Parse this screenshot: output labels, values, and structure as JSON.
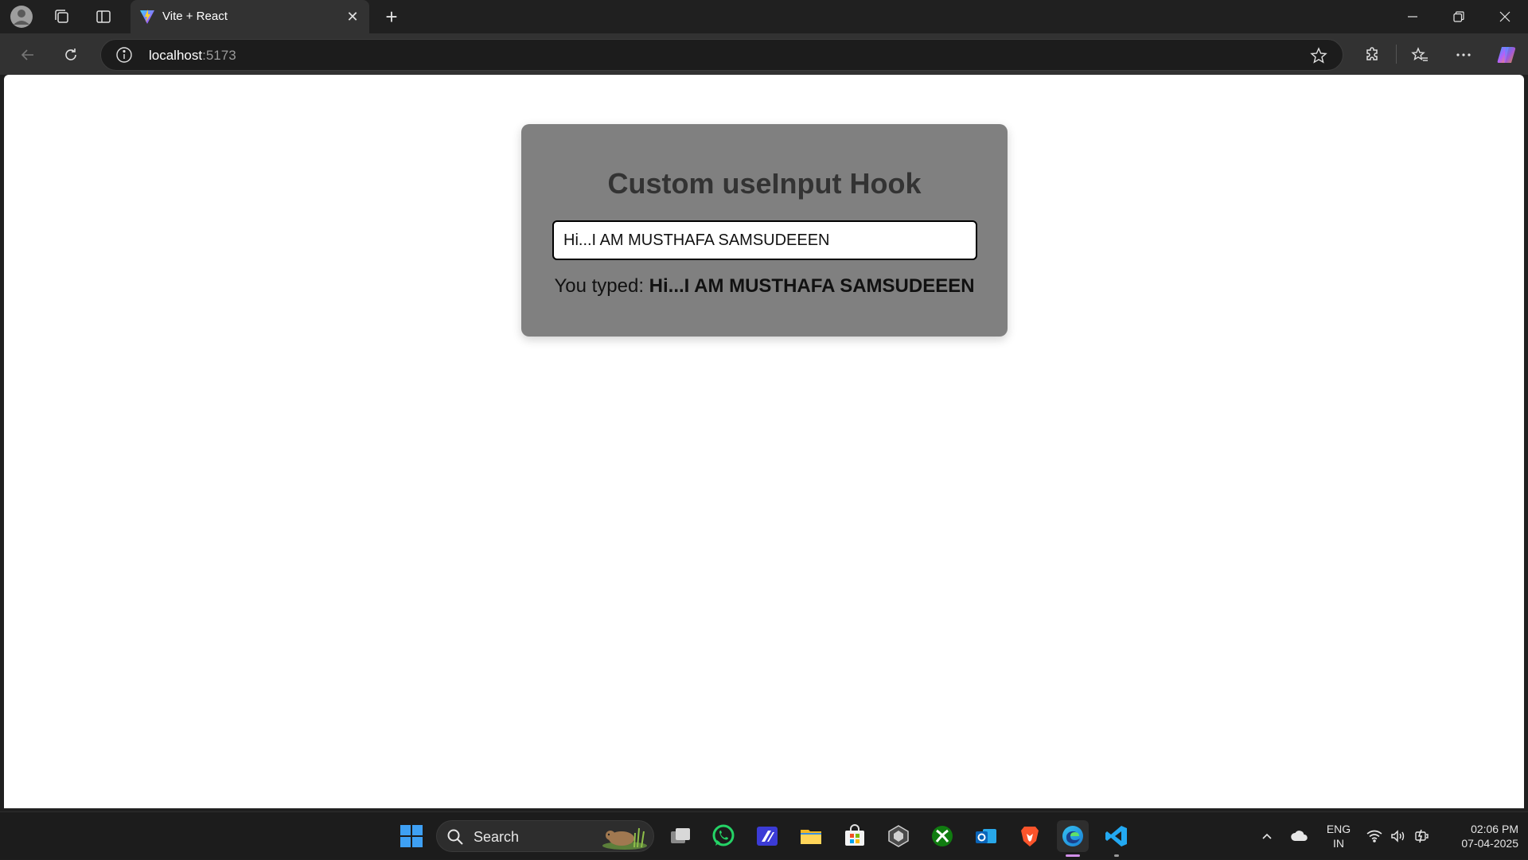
{
  "browser": {
    "tab": {
      "title": "Vite + React",
      "close_glyph": "✕"
    },
    "new_tab_glyph": "+",
    "address": {
      "host": "localhost",
      "port": ":5173"
    },
    "window_controls": {
      "minimize": "—",
      "maximize": "❐",
      "close": "✕"
    }
  },
  "page": {
    "title": "Custom useInput Hook",
    "input_value": "Hi...I AM MUSTHAFA SAMSUDEEEN",
    "typed_label": "You typed:",
    "typed_value": "Hi...I AM MUSTHAFA SAMSUDEEEN",
    "card_color": "#808080"
  },
  "taskbar": {
    "search_label": "Search",
    "language_line1": "ENG",
    "language_line2": "IN",
    "time": "02:06 PM",
    "date": "07-04-2025",
    "apps": [
      "start-icon",
      "task-view-icon",
      "whatsapp-icon",
      "powertoys-icon",
      "file-explorer-icon",
      "microsoft-store-icon",
      "unity-icon",
      "xbox-icon",
      "outlook-icon",
      "brave-icon",
      "edge-icon",
      "vscode-icon"
    ]
  }
}
